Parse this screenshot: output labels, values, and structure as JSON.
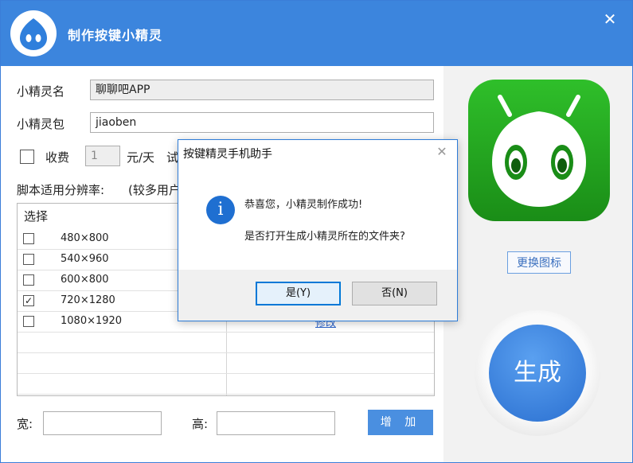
{
  "window": {
    "title": "制作按键小精灵",
    "close_glyph": "✕",
    "accent": "#3c85dd"
  },
  "form": {
    "name_label": "小精灵名",
    "name_value": "聊聊吧APP",
    "package_label": "小精灵包",
    "package_value": "jiaoben",
    "fee_label": "收费",
    "fee_value": "1",
    "fee_unit": "元/天",
    "fee_trailing": "试",
    "resolution_label": "脚本适用分辨率:",
    "resolution_hint": "(较多用户"
  },
  "grid": {
    "header": "选择",
    "rows": [
      {
        "res": "480×800",
        "checked": false
      },
      {
        "res": "540×960",
        "checked": false
      },
      {
        "res": "600×800",
        "checked": false
      },
      {
        "res": "720×1280",
        "checked": true
      },
      {
        "res": "1080×1920",
        "checked": false
      }
    ],
    "visible_edit_text": "修改"
  },
  "bottom": {
    "width_label": "宽:",
    "height_label": "高:",
    "add_button": "增 加"
  },
  "right_panel": {
    "change_icon_button": "更换图标",
    "generate_button": "生成"
  },
  "dialog": {
    "title": "按键精灵手机助手",
    "close_glyph": "✕",
    "icon": "info-icon",
    "icon_glyph": "i",
    "message_line1": "恭喜您，小精灵制作成功!",
    "message_line2": "是否打开生成小精灵所在的文件夹?",
    "yes_button": "是(Y)",
    "no_button": "否(N)"
  }
}
